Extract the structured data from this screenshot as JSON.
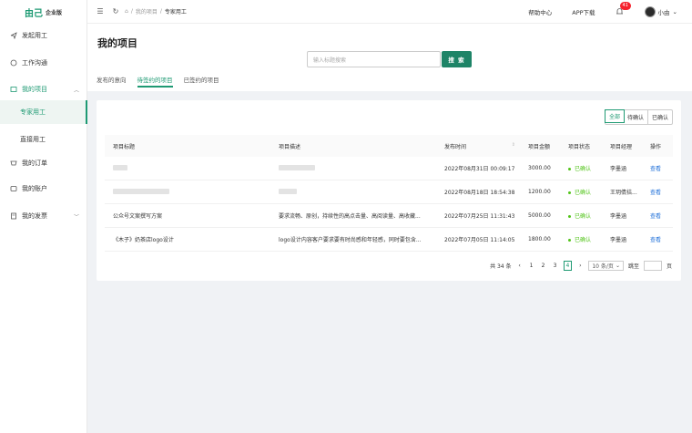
{
  "brand": {
    "name": "由己",
    "edition": "企业版"
  },
  "sidebar": {
    "items": [
      {
        "label": "发起用工",
        "icon": "send-icon"
      },
      {
        "label": "工作沟通",
        "icon": "chat-icon"
      },
      {
        "label": "我的项目",
        "icon": "project-icon"
      },
      {
        "label": "我的订单",
        "icon": "order-icon"
      },
      {
        "label": "我的账户",
        "icon": "account-icon"
      },
      {
        "label": "我的发票",
        "icon": "invoice-icon"
      }
    ],
    "sub_items": [
      {
        "label": "专家用工"
      },
      {
        "label": "直接用工"
      }
    ]
  },
  "header": {
    "breadcrumb": [
      "我的项目",
      "专家用工"
    ],
    "help": "帮助中心",
    "app": "APP下载",
    "notifications": "41",
    "username": "小由"
  },
  "main": {
    "title": "我的项目",
    "search_placeholder": "输入标题搜索",
    "search_button": "搜 索",
    "tabs": [
      "发布的意向",
      "待签约的项目",
      "已签约的项目"
    ],
    "filters": [
      "全部",
      "待确认",
      "已确认"
    ],
    "columns": [
      "项目标题",
      "项目描述",
      "发布时间",
      "项目金额",
      "项目状态",
      "项目经理",
      "操作"
    ],
    "rows": [
      {
        "title": "",
        "desc": "",
        "time": "2022年08月31日 00:09:17",
        "amount": "3000.00",
        "status": "已确认",
        "manager": "李墨涵",
        "action": "查看"
      },
      {
        "title": "",
        "desc": "",
        "time": "2022年08月18日 18:54:38",
        "amount": "1200.00",
        "status": "已确认",
        "manager": "王玥倩拮...",
        "action": "查看"
      },
      {
        "title": "公众号文案撰写方案",
        "desc": "要求流畅、原创，持续性的高点击量、高阅读量、高收藏...",
        "time": "2022年07月25日 11:31:43",
        "amount": "5000.00",
        "status": "已确认",
        "manager": "李墨涵",
        "action": "查看"
      },
      {
        "title": "《木子》奶茶店logo设计",
        "desc": "logo设计内容客户要求要有时尚感和年轻感，同时要包含...",
        "time": "2022年07月05日 11:14:05",
        "amount": "1800.00",
        "status": "已确认",
        "manager": "李墨涵",
        "action": "查看"
      }
    ],
    "pagination": {
      "total": "共 34 条",
      "pages": [
        "1",
        "2",
        "3",
        "4"
      ],
      "current": "4",
      "page_size": "10 条/页",
      "jump_label": "跳至",
      "page_unit": "页"
    }
  }
}
